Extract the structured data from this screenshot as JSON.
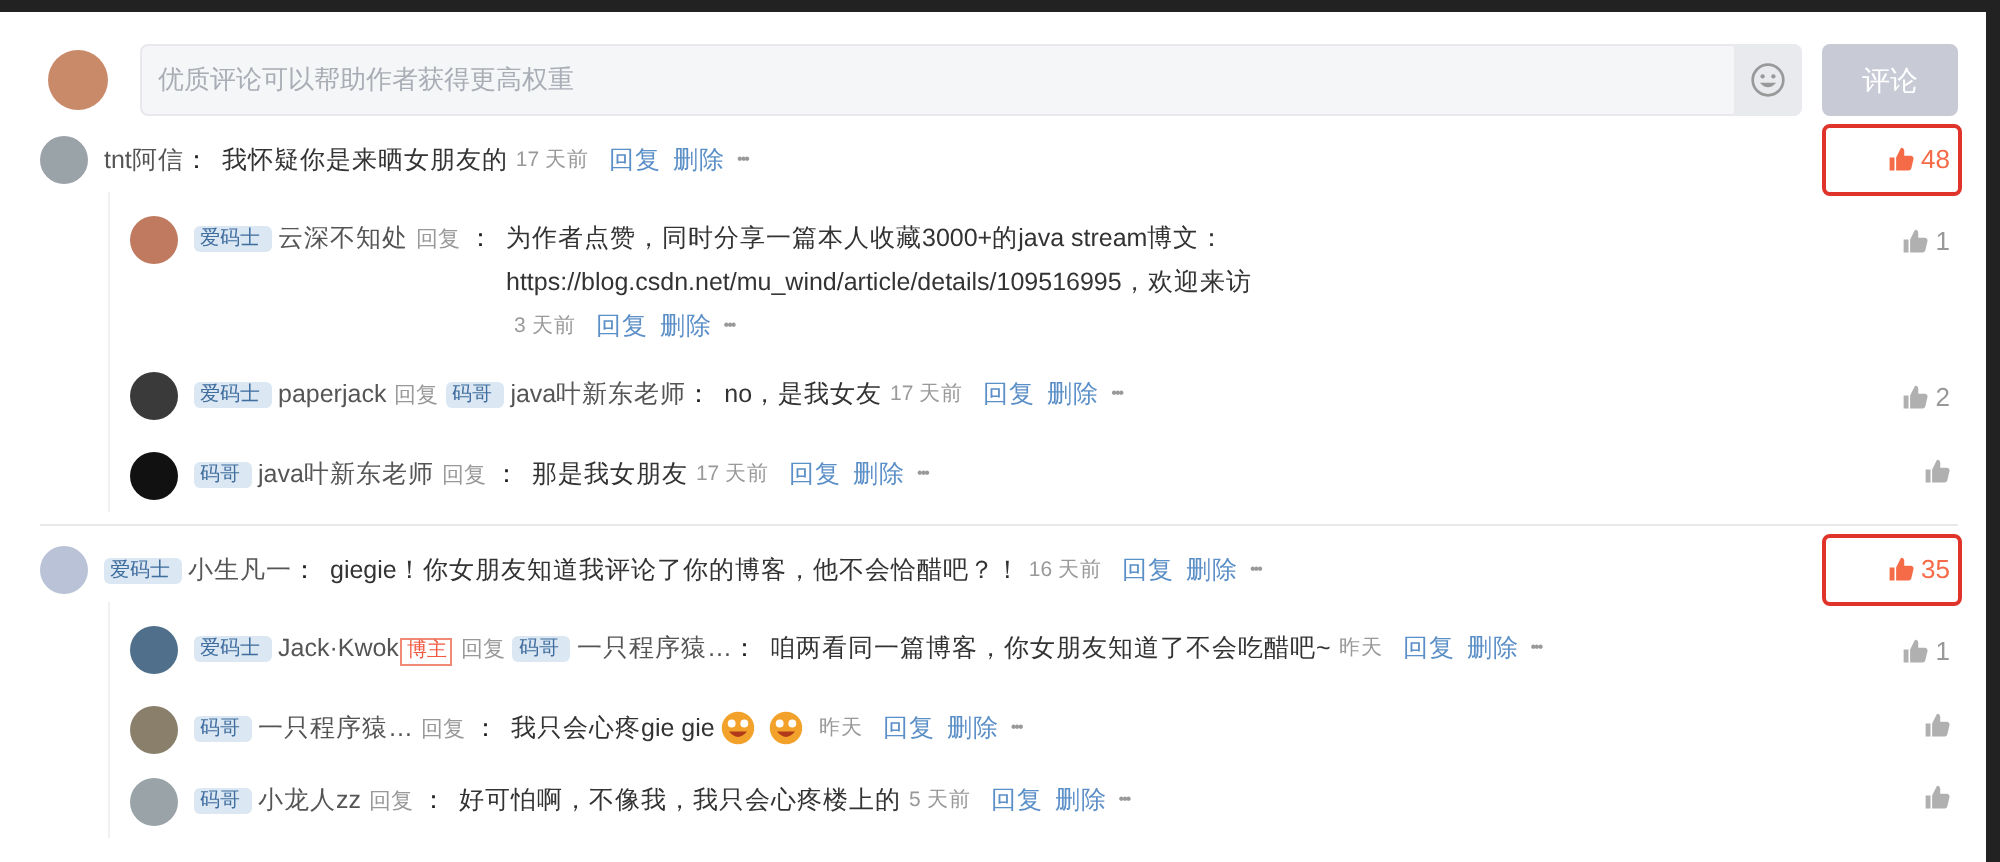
{
  "comment_box": {
    "placeholder": "优质评论可以帮助作者获得更高权重",
    "submit": "评论"
  },
  "threads": [
    {
      "name": "tnt阿信",
      "colon": "：",
      "text": "我怀疑你是来晒女朋友的",
      "time": "17 天前",
      "reply": "回复",
      "delete": "删除",
      "more": "•••",
      "likes": "48",
      "liked": true,
      "highlighted": true,
      "replies": [
        {
          "badge": "爱码士",
          "name": "云深不知处",
          "reply_word": "回复",
          "colon": "：",
          "text": "为作者点赞，同时分享一篇本人收藏3000+的java stream博文：https://blog.csdn.net/mu_wind/article/details/109516995，欢迎来访",
          "time": "3 天前",
          "reply": "回复",
          "delete": "删除",
          "more": "•••",
          "likes": "1",
          "liked": false
        },
        {
          "badge": "爱码士",
          "name": "paperjack",
          "reply_word": "回复",
          "target": {
            "badge": "码哥",
            "name": "java叶新东老师"
          },
          "colon": "：",
          "text": "no，是我女友",
          "time": "17 天前",
          "reply": "回复",
          "delete": "删除",
          "more": "•••",
          "likes": "2",
          "liked": false
        },
        {
          "badge": "码哥",
          "name": "java叶新东老师",
          "reply_word": "回复",
          "colon": "：",
          "text": "那是我女朋友",
          "time": "17 天前",
          "reply": "回复",
          "delete": "删除",
          "more": "•••",
          "liked": false
        }
      ]
    },
    {
      "badge": "爱码士",
      "name": "小生凡一",
      "colon": "：",
      "text": "giegie！你女朋友知道我评论了你的博客，他不会恰醋吧？！",
      "time": "16 天前",
      "reply": "回复",
      "delete": "删除",
      "more": "•••",
      "likes": "35",
      "liked": true,
      "highlighted": true,
      "replies": [
        {
          "badge": "爱码士",
          "name": "Jack·Kwok",
          "author_tag": "博主",
          "reply_word": "回复",
          "target": {
            "badge": "码哥",
            "name": "一只程序猿…"
          },
          "colon": "：",
          "text": "咱两看同一篇博客，你女朋友知道了不会吃醋吧~",
          "time": "昨天",
          "reply": "回复",
          "delete": "删除",
          "more": "•••",
          "likes": "1",
          "liked": false
        },
        {
          "badge": "码哥",
          "name": "一只程序猿…",
          "reply_word": "回复",
          "colon": "：",
          "text": "我只会心疼gie gie",
          "emojis": [
            {
              "kind": "grin"
            },
            {
              "kind": "grin"
            }
          ],
          "time": "昨天",
          "reply": "回复",
          "delete": "删除",
          "more": "•••",
          "liked": false
        },
        {
          "badge": "码哥",
          "name": "小龙人zz",
          "reply_word": "回复",
          "colon": "：",
          "text": "好可怕啊，不像我，我只会心疼楼上的",
          "time": "5 天前",
          "reply": "回复",
          "delete": "删除",
          "more": "•••",
          "liked": false
        }
      ]
    }
  ]
}
